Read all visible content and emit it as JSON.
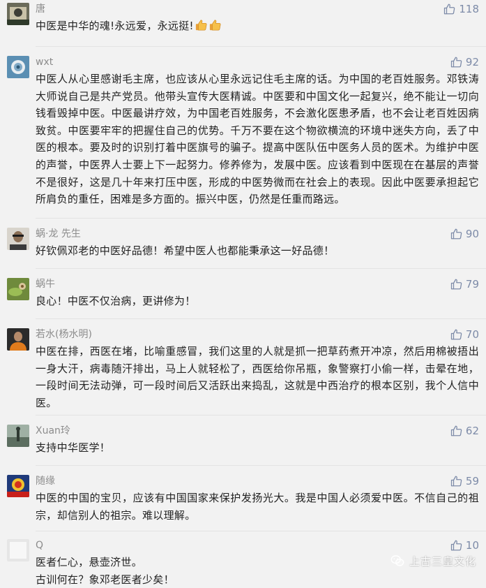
{
  "comments": [
    {
      "user": "唐",
      "likes": "118",
      "text": "中医是中华的魂!永远爱，永远挺!",
      "emoji": [
        "thumbs-up",
        "thumbs-up"
      ]
    },
    {
      "user": "wxt",
      "likes": "92",
      "text": "中医人从心里感谢毛主席，也应该从心里永远记住毛主席的话。为中国的老百姓服务。邓铁涛大师说自己是共产党员。他带头宣传大医精诚。中医要和中国文化一起复兴，绝不能让一切向钱看毁掉中医。中医最讲疗效，为中国老百姓服务，不会激化医患矛盾，也不会让老百姓因病致贫。中医要牢牢的把握住自己的优势。千万不要在这个物欲横流的环境中迷失方向，丢了中医的根本。要及时的识别打着中医旗号的骗子。提高中医队伍中医务人员的医术。为维护中医的声誉，中医界人士要上下一起努力。修养修为，发展中医。应该看到中医现在在基层的声誉不是很好，这是几十年来打压中医，形成的中医势微而在社会上的表现。因此中医要承担起它所肩负的重任，困难是多方面的。振兴中医，仍然是任重而路远。"
    },
    {
      "user": "蜗·龙 先生",
      "likes": "90",
      "text": "好钦佩邓老的中医好品德！希望中医人也都能秉承这一好品德！"
    },
    {
      "user": "蜗牛",
      "likes": "79",
      "text": "良心！中医不仅治病，更讲修为！"
    },
    {
      "user": "若水(杨水明)",
      "likes": "70",
      "text": "中医在排，西医在堵，比喻重感冒，我们这里的人就是抓一把草药煮开冲凉，然后用棉被捂出一身大汗，病毒随汗排出，马上人就轻松了，西医给你吊瓶，象警察打小偷一样，击晕在地，一段时间无法动弹，可一段时间后又活跃出来捣乱，这就是中西治疗的根本区别，我个人信中医。"
    },
    {
      "user": "Xuan玲",
      "likes": "62",
      "text": "支持中华医学！"
    },
    {
      "user": "随缘",
      "likes": "59",
      "text": "中医的中国的宝贝，应该有中国国家来保护发扬光大。我是中国人必须爱中医。不信自己的祖宗，却信别人的祖宗。难以理解。"
    },
    {
      "user": "Q",
      "likes": "10",
      "text": "医者仁心，悬壶济世。\n古训何在？象邓老医者少矣！"
    }
  ],
  "watermark": {
    "label": "上古三皇文化",
    "icon": "wechat-icon"
  },
  "colors": {
    "background": "#f2f2f2",
    "username": "#8c8c8c",
    "text": "#222222",
    "like": "#7d8ba8",
    "divider": "#e3e3e3"
  }
}
